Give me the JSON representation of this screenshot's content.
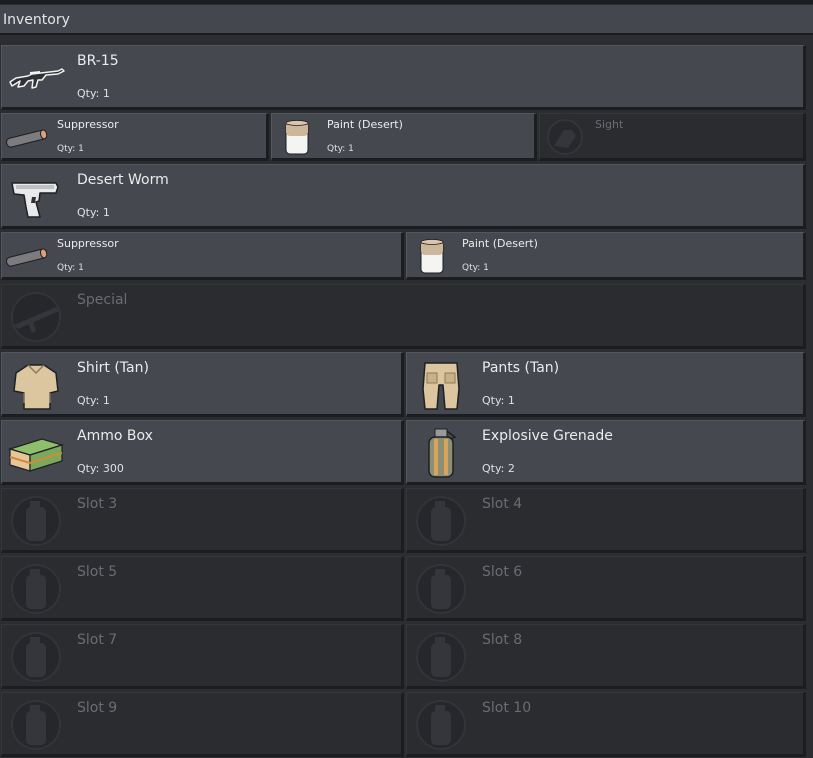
{
  "header": {
    "title": "Inventory"
  },
  "primary": {
    "name": "BR-15",
    "qty": "Qty: 1",
    "icon": "rifle-icon",
    "attachments": [
      {
        "name": "Suppressor",
        "qty": "Qty: 1",
        "icon": "suppressor-icon"
      },
      {
        "name": "Paint (Desert)",
        "qty": "Qty: 1",
        "icon": "paint-can-icon"
      },
      {
        "name": "Sight",
        "qty": "",
        "icon": "sight-placeholder-icon",
        "empty": true
      }
    ]
  },
  "secondary": {
    "name": "Desert Worm",
    "qty": "Qty: 1",
    "icon": "pistol-icon",
    "attachments": [
      {
        "name": "Suppressor",
        "qty": "Qty: 1",
        "icon": "suppressor-icon"
      },
      {
        "name": "Paint (Desert)",
        "qty": "Qty: 1",
        "icon": "paint-can-icon"
      }
    ]
  },
  "special": {
    "name": "Special",
    "icon": "launcher-placeholder-icon"
  },
  "items": [
    {
      "name": "Shirt (Tan)",
      "qty": "Qty: 1",
      "icon": "shirt-icon"
    },
    {
      "name": "Pants (Tan)",
      "qty": "Qty: 1",
      "icon": "pants-icon"
    },
    {
      "name": "Ammo Box",
      "qty": "Qty: 300",
      "icon": "ammo-box-icon"
    },
    {
      "name": "Explosive Grenade",
      "qty": "Qty: 2",
      "icon": "grenade-icon"
    },
    {
      "name": "Slot 3",
      "icon": "grenade-placeholder-icon"
    },
    {
      "name": "Slot 4",
      "icon": "grenade-placeholder-icon"
    },
    {
      "name": "Slot 5",
      "icon": "grenade-placeholder-icon"
    },
    {
      "name": "Slot 6",
      "icon": "grenade-placeholder-icon"
    },
    {
      "name": "Slot 7",
      "icon": "grenade-placeholder-icon"
    },
    {
      "name": "Slot 8",
      "icon": "grenade-placeholder-icon"
    },
    {
      "name": "Slot 9",
      "icon": "grenade-placeholder-icon"
    },
    {
      "name": "Slot 10",
      "icon": "grenade-placeholder-icon"
    }
  ],
  "colors": {
    "panel": "#46484f",
    "empty_panel": "#2a2c30",
    "background": "#2b2d31"
  }
}
